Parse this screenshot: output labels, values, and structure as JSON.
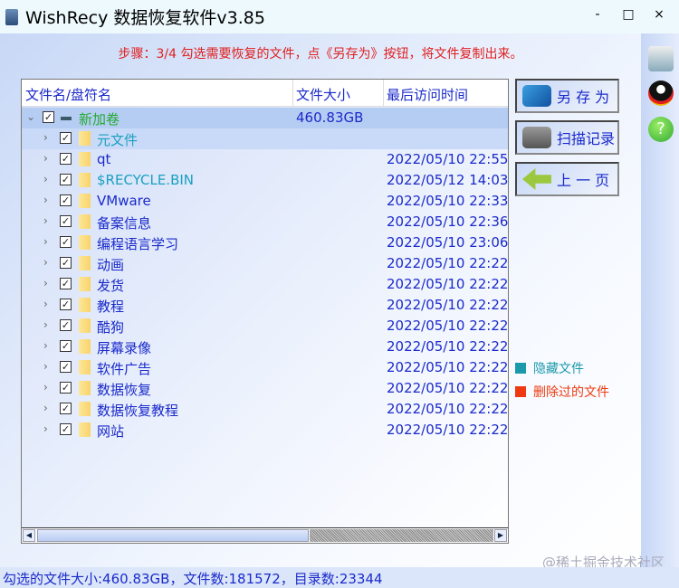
{
  "window": {
    "title": "WishRecy 数据恢复软件v3.85",
    "minimize": "-",
    "maximize": "□",
    "close": "×"
  },
  "step_text": "步骤：3/4 勾选需要恢复的文件，点《另存为》按钮，将文件复制出来。",
  "columns": {
    "name": "文件名/盘符名",
    "size": "文件大小",
    "time": "最后访问时间"
  },
  "root": {
    "name": "新加卷",
    "size": "460.83GB",
    "color": "#22aa33"
  },
  "items": [
    {
      "name": "元文件",
      "time": "",
      "color": "#1aa0c0"
    },
    {
      "name": "qt",
      "time": "2022/05/10 22:55:",
      "color": "#1a2acb"
    },
    {
      "name": "$RECYCLE.BIN",
      "time": "2022/05/12 14:03:",
      "color": "#1aa0c0"
    },
    {
      "name": "VMware",
      "time": "2022/05/10 22:33:",
      "color": "#1a2acb"
    },
    {
      "name": "备案信息",
      "time": "2022/05/10 22:36:",
      "color": "#1a2acb"
    },
    {
      "name": "编程语言学习",
      "time": "2022/05/10 23:06:",
      "color": "#1a2acb"
    },
    {
      "name": "动画",
      "time": "2022/05/10 22:22:",
      "color": "#1a2acb"
    },
    {
      "name": "发货",
      "time": "2022/05/10 22:22:",
      "color": "#1a2acb"
    },
    {
      "name": "教程",
      "time": "2022/05/10 22:22:",
      "color": "#1a2acb"
    },
    {
      "name": "酷狗",
      "time": "2022/05/10 22:22:",
      "color": "#1a2acb"
    },
    {
      "name": "屏幕录像",
      "time": "2022/05/10 22:22:",
      "color": "#1a2acb"
    },
    {
      "name": "软件广告",
      "time": "2022/05/10 22:22:",
      "color": "#1a2acb"
    },
    {
      "name": "数据恢复",
      "time": "2022/05/10 22:22:",
      "color": "#1a2acb"
    },
    {
      "name": "数据恢复教程",
      "time": "2022/05/10 22:22:",
      "color": "#1a2acb"
    },
    {
      "name": "网站",
      "time": "2022/05/10 22:22:",
      "color": "#1a2acb"
    }
  ],
  "buttons": {
    "save_as": "另 存 为",
    "scan_log": "扫描记录",
    "prev": "上 一 页"
  },
  "legend": [
    {
      "label": "隐藏文件",
      "color": "#1a9aaa"
    },
    {
      "label": "删除过的文件",
      "color": "#ee3a10"
    }
  ],
  "status": "勾选的文件大小:460.83GB，文件数:181572，目录数:23344",
  "watermark": "@稀土掘金技术社区"
}
